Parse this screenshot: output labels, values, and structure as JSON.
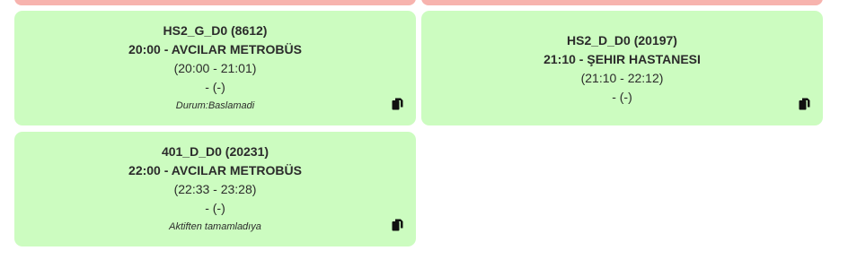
{
  "cards": [
    {
      "code": "HS2_G_D0 (8612)",
      "destination": "20:00 - AVCILAR METROBÜS",
      "time_range": "(20:00 - 21:01)",
      "extra": "- (-)",
      "status": "Durum:Baslamadi"
    },
    {
      "code": "HS2_D_D0 (20197)",
      "destination": "21:10 - ŞEHIR HASTANESI",
      "time_range": "(21:10 - 22:12)",
      "extra": "- (-)",
      "status": ""
    },
    {
      "code": "401_D_D0 (20231)",
      "destination": "22:00 - AVCILAR METROBÜS",
      "time_range": "(22:33 - 23:28)",
      "extra": "- (-)",
      "status": "Aktiften tamamladıya"
    }
  ],
  "colors": {
    "pink_card": "#f7b3ae",
    "green_card": "#ccfcc0",
    "text": "#2b2b2b"
  },
  "icons": {
    "copy": "copy-icon"
  }
}
